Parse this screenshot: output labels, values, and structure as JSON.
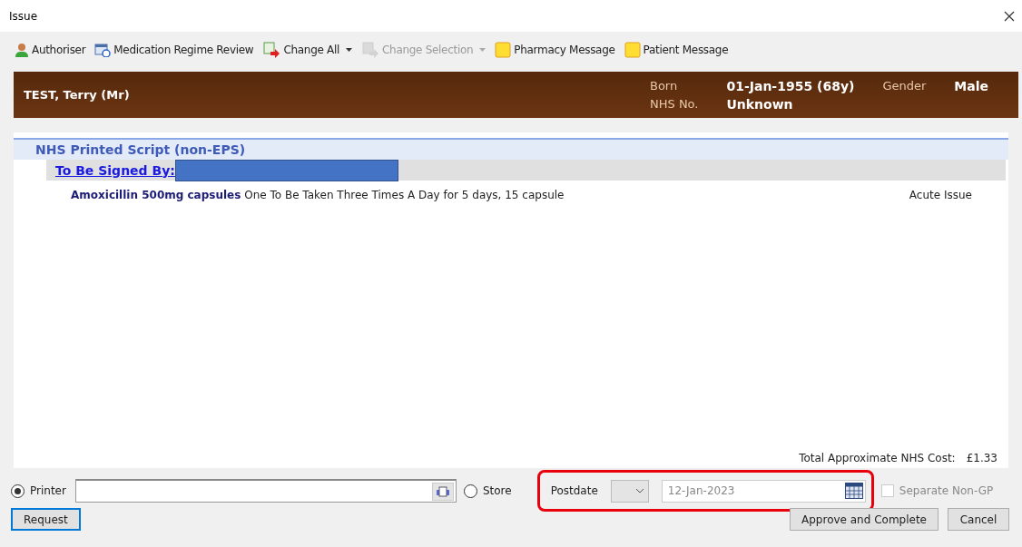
{
  "window": {
    "title": "Issue"
  },
  "toolbar": [
    {
      "label": "Authoriser",
      "kind": "person",
      "disabled": false,
      "dropdown": false
    },
    {
      "label": "Medication Regime Review",
      "kind": "calendar",
      "disabled": false,
      "dropdown": false
    },
    {
      "label": "Change All",
      "kind": "change",
      "disabled": false,
      "dropdown": true
    },
    {
      "label": "Change Selection",
      "kind": "change",
      "disabled": true,
      "dropdown": true
    },
    {
      "label": "Pharmacy Message",
      "kind": "note",
      "disabled": false,
      "dropdown": false
    },
    {
      "label": "Patient Message",
      "kind": "note",
      "disabled": false,
      "dropdown": false
    }
  ],
  "patient": {
    "name": "TEST, Terry (Mr)",
    "born_label": "Born",
    "born": "01-Jan-1955 (68y)",
    "gender_label": "Gender",
    "gender": "Male",
    "nhs_label": "NHS No.",
    "nhs": "Unknown"
  },
  "script": {
    "heading": "NHS Printed Script (non-EPS)",
    "signed_by_label": "To Be Signed By:",
    "signer_redacted": true,
    "items": [
      {
        "drug": "Amoxicillin 500mg capsules",
        "dosage": "One To Be Taken Three Times A Day for 5 days, 15 capsule",
        "type": "Acute Issue"
      }
    ],
    "total_label": "Total Approximate NHS Cost:",
    "total": "£1.33"
  },
  "output": [
    {
      "label": "Printer",
      "selected": true
    },
    {
      "label": "Store",
      "selected": false
    }
  ],
  "postdate": {
    "label": "Postdate",
    "date": "12-Jan-2023",
    "highlighted": true
  },
  "separate_non_gp": {
    "label": "Separate Non-GP",
    "checked": false,
    "disabled": true
  },
  "buttons": {
    "left": "Request",
    "approve": "Approve and Complete",
    "cancel": "Cancel"
  }
}
